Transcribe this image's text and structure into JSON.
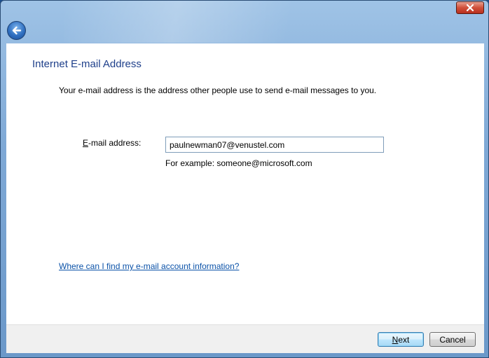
{
  "wizard": {
    "title": "Internet E-mail Address",
    "intro": "Your e-mail address is the address other people use to send e-mail messages to you.",
    "email_label_prefix": "E",
    "email_label_rest": "-mail address:",
    "email_value": "paulnewman07@venustel.com",
    "example": "For example: someone@microsoft.com",
    "help_link": "Where can I find my e-mail account information?"
  },
  "footer": {
    "next_prefix": "N",
    "next_rest": "ext",
    "cancel_label": "Cancel"
  },
  "icons": {
    "back": "back-arrow-icon",
    "close": "close-icon"
  }
}
